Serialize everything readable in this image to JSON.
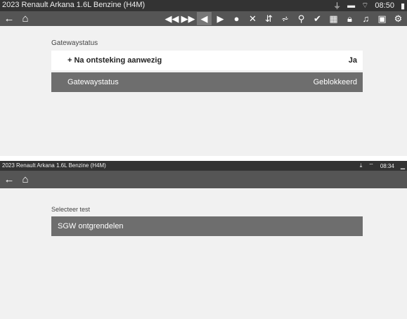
{
  "panel1": {
    "status": {
      "title": "2023 Renault Arkana 1.6L Benzine (H4M)",
      "time": "08:50"
    },
    "section_label": "Gatewaystatus",
    "rows": [
      {
        "label": "+ Na ontsteking aanwezig",
        "value": "Ja"
      },
      {
        "label": "Gatewaystatus",
        "value": "Geblokkeerd"
      }
    ]
  },
  "panel2": {
    "status": {
      "title": "2023 Renault Arkana 1.6L Benzine (H4M)",
      "time": "08:34"
    },
    "section_label": "Selecteer test",
    "test_button": "SGW ontgrendelen"
  }
}
